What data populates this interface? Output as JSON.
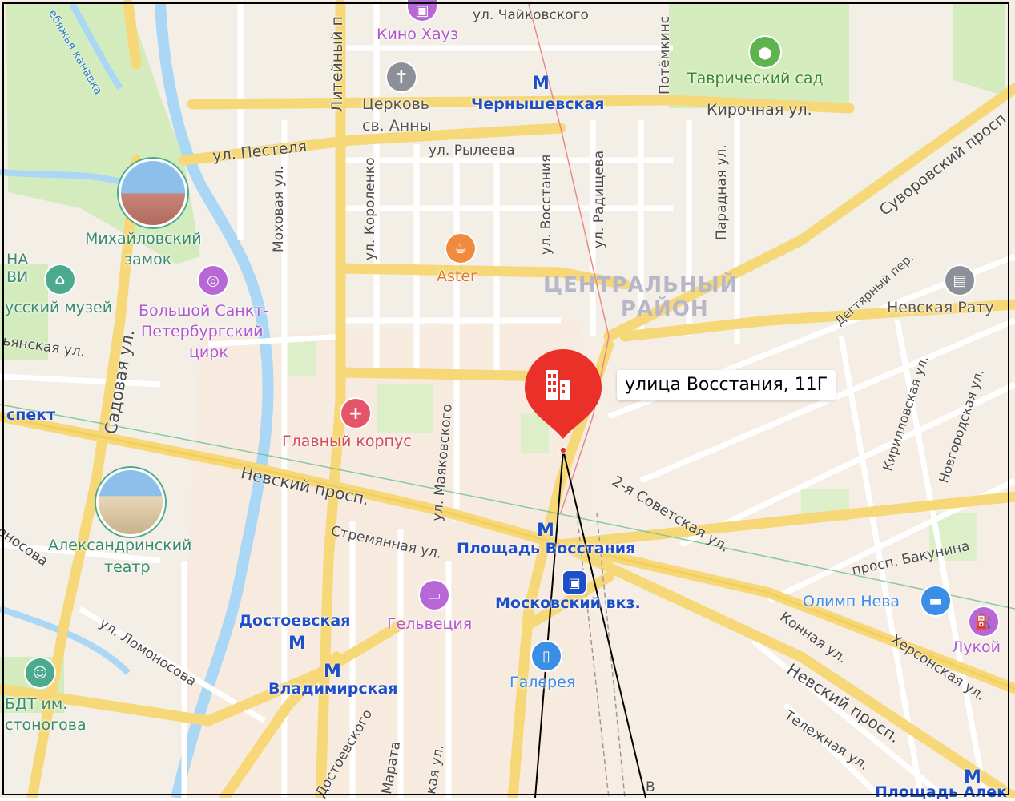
{
  "marker": {
    "address": "улица Восстания, 11Г",
    "color": "#e9312a"
  },
  "district": {
    "line1": "ЦЕНТРАЛЬНЫЙ",
    "line2": "РАЙОН"
  },
  "streets": {
    "chaikovskogo": "ул. Чайковского",
    "liteyny": "Литейный п",
    "potemkinskaya": "Потёмкинс",
    "kirochnaya": "Кирочная ул.",
    "pestelya": "ул. Пестеля",
    "ryleeva": "ул. Рылеева",
    "mokhovaya": "Моховая ул.",
    "korolenko": "ул. Короленко",
    "vosstaniya": "ул. Восстания",
    "radishcheva": "ул. Радищева",
    "paradnaya": "Парадная ул.",
    "suvorovsky": "Суворовский просп",
    "degtyarny": "Дегтярный пер.",
    "sadovaya": "Садовая ул.",
    "inzhenernaya": "ьянская ул.",
    "prospekt_left": "спект",
    "nevsky": "Невский просп.",
    "mayakovskogo": "ул. Маяковского",
    "sovetskaya2": "2-я Советская ул.",
    "kirillovskaya": "Кирилловская ул.",
    "novgorodskaya": "Новгородская ул.",
    "stremyannaya": "Стремянная ул.",
    "bakunina": "просп. Бакунина",
    "konnaya": "Конная ул.",
    "khersonskaya": "Херсонская ул.",
    "nevsky2": "Невский просп.",
    "lomonosova": "ул. Ломоносова",
    "lomonosova_left": "оносова",
    "telezhnaya": "Тележная ул.",
    "dostoevskogo": "Достоевского",
    "marata": "Марата",
    "kaya": "кая ул.",
    "v_bottom": "В",
    "fontanka": "ебяжья канавка"
  },
  "pois": {
    "kino": "Кино Хауз",
    "tserkov1": "Церковь",
    "tserkov2": "св. Анны",
    "tavrichesky": "Таврический сад",
    "aster": "Aster",
    "mikhailovsky1": "Михайловский",
    "mikhailovsky2": "замок",
    "na": "НА",
    "vi": "ВИ",
    "russkiy": "усский музей",
    "tsirk1": "Большой Санкт-",
    "tsirk2": "Петербургский",
    "tsirk3": "цирк",
    "nevskaya_ratusha": "Невская Рату",
    "glavny": "Главный корпус",
    "aleksandrinsky1": "Александринский",
    "aleksandrinsky2": "театр",
    "olimp": "Олимп Нева",
    "lukoil": "Лукой",
    "gelvetsiya": "Гельвеция",
    "moskovsky": "Московский вкз.",
    "galereya": "Галерея",
    "bdt1": "БДТ им.",
    "bdt2": "стоногова"
  },
  "metro": {
    "chernyshevskaya": "Чернышевская",
    "ploshchad": "Площадь Восстания",
    "dostoevskaya": "Достоевская",
    "vladimirskaya": "Владимирская",
    "ploshchad_alex": "Площадь Алек",
    "symbol": "M"
  },
  "colors": {
    "road_major": "#f7d878",
    "road_minor": "#ffffff",
    "block": "#f5f2ea",
    "park": "#d2eeb6",
    "water": "#a9d7f5",
    "metro_blue": "#1e4fc8",
    "poi_purple": "#9b5bd2",
    "poi_red": "#e4556a",
    "poi_orange": "#f08a3c",
    "poi_gray": "#8e9099",
    "poi_green": "#5fb34d",
    "poi_teal": "#4caa8f",
    "poi_blue": "#3a8ee6"
  }
}
